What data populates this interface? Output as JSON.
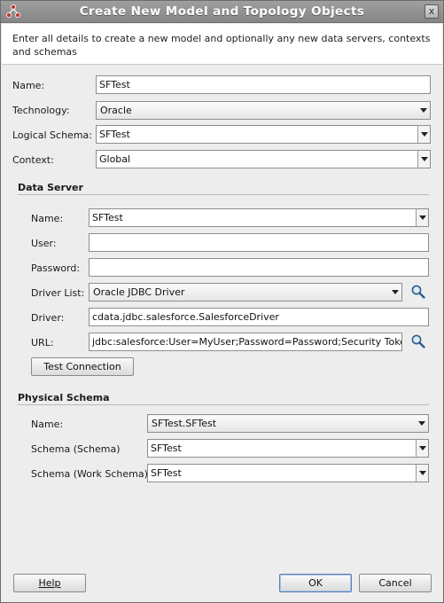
{
  "window": {
    "title": "Create New Model and Topology Objects",
    "close_glyph": "x"
  },
  "banner": {
    "text": "Enter all details to create a new model and optionally any new data servers, contexts and schemas"
  },
  "model": {
    "name_label": "Name:",
    "name_value": "SFTest",
    "technology_label": "Technology:",
    "technology_value": "Oracle",
    "logical_schema_label": "Logical Schema:",
    "logical_schema_value": "SFTest",
    "context_label": "Context:",
    "context_value": "Global"
  },
  "data_server": {
    "heading": "Data Server",
    "name_label": "Name:",
    "name_value": "SFTest",
    "user_label": "User:",
    "user_value": "",
    "password_label": "Password:",
    "password_value": "",
    "driver_list_label": "Driver List:",
    "driver_list_value": "Oracle JDBC Driver",
    "driver_label": "Driver:",
    "driver_value": "cdata.jdbc.salesforce.SalesforceDriver",
    "url_label": "URL:",
    "url_value": "jdbc:salesforce:User=MyUser;Password=Password;Security Token",
    "test_button": "Test Connection"
  },
  "physical_schema": {
    "heading": "Physical Schema",
    "name_label": "Name:",
    "name_value": "SFTest.SFTest",
    "schema_label": "Schema (Schema)",
    "schema_value": "SFTest",
    "work_schema_label": "Schema (Work Schema)",
    "work_schema_value": "SFTest"
  },
  "footer": {
    "help_label": "Help",
    "ok_label": "OK",
    "cancel_label": "Cancel"
  },
  "icons": {
    "app": "odi-model-icon",
    "search": "search-icon"
  }
}
